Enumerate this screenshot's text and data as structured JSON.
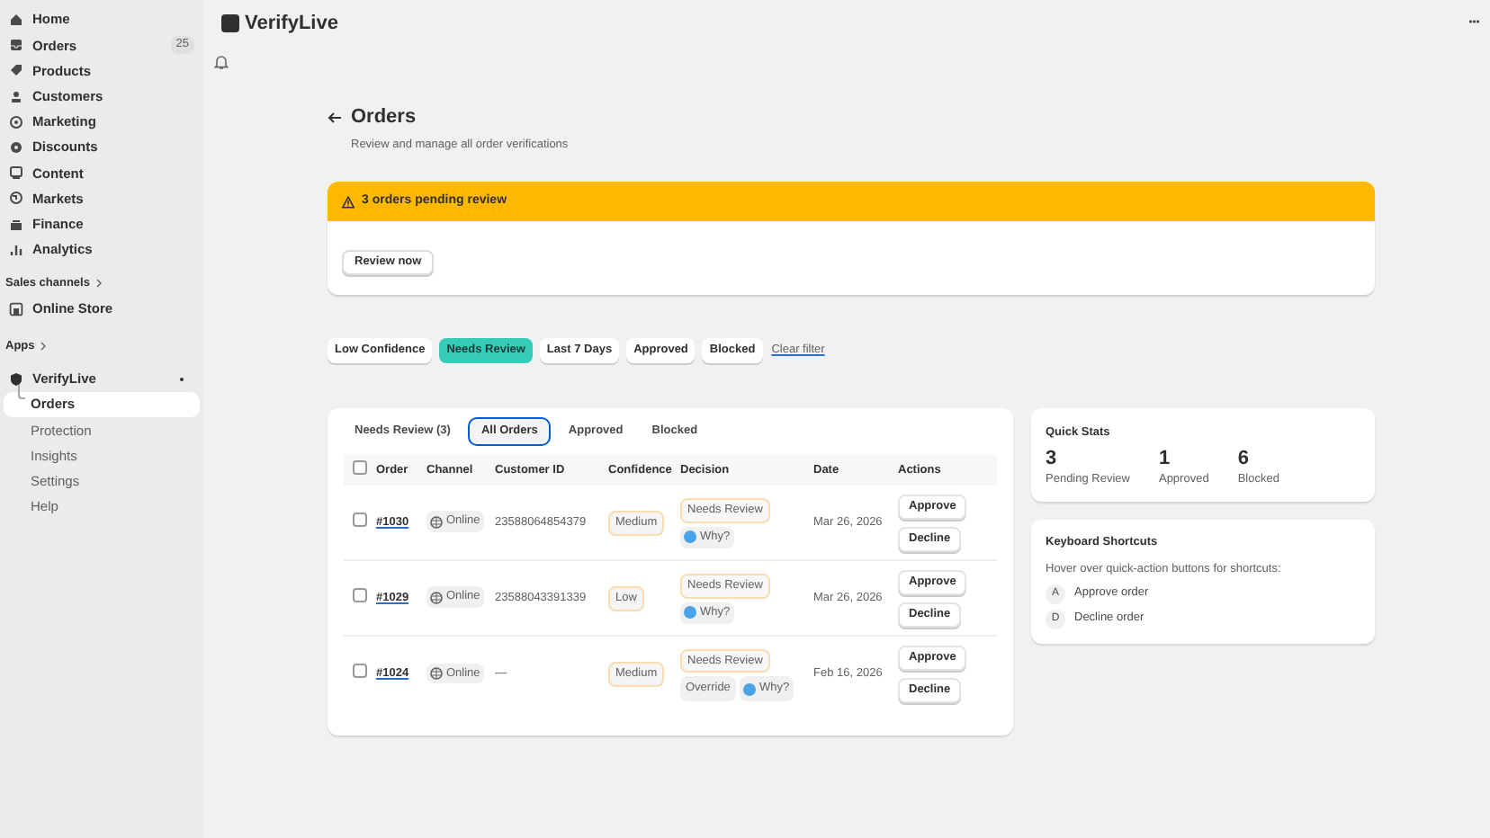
{
  "sidebar": {
    "items": [
      {
        "label": "Home"
      },
      {
        "label": "Orders",
        "badge": "25"
      },
      {
        "label": "Products"
      },
      {
        "label": "Customers"
      },
      {
        "label": "Marketing"
      },
      {
        "label": "Discounts"
      },
      {
        "label": "Content"
      },
      {
        "label": "Markets"
      },
      {
        "label": "Finance"
      },
      {
        "label": "Analytics"
      }
    ],
    "sales_channels": {
      "heading": "Sales channels",
      "items": [
        {
          "label": "Online Store"
        }
      ]
    },
    "apps": {
      "heading": "Apps",
      "app": {
        "label": "VerifyLive",
        "children": [
          {
            "label": "Orders",
            "selected": true
          },
          {
            "label": "Protection",
            "selected": false
          },
          {
            "label": "Insights",
            "selected": false
          },
          {
            "label": "Settings",
            "selected": false
          },
          {
            "label": "Help",
            "selected": false
          }
        ]
      }
    }
  },
  "topbar": {
    "title": "VerifyLive",
    "menu": "···"
  },
  "page": {
    "title": "Orders",
    "subtitle": "Review and manage all order verifications"
  },
  "banner": {
    "message": "3 orders pending review",
    "button": "Review now"
  },
  "filters": {
    "chips": [
      {
        "label": "Low Confidence",
        "selected": false
      },
      {
        "label": "Needs Review",
        "selected": true
      },
      {
        "label": "Last 7 Days",
        "selected": false
      },
      {
        "label": "Approved",
        "selected": false
      },
      {
        "label": "Blocked",
        "selected": false
      }
    ],
    "clear": "Clear filter"
  },
  "table": {
    "tabs": [
      {
        "label": "Needs Review (3)",
        "selected": false
      },
      {
        "label": "All Orders",
        "selected": true
      },
      {
        "label": "Approved",
        "selected": false
      },
      {
        "label": "Blocked",
        "selected": false
      }
    ],
    "select_all": {
      "checked": false
    },
    "columns": [
      "Order",
      "Channel",
      "Customer ID",
      "Confidence",
      "Decision",
      "Date",
      "Actions"
    ],
    "rows": [
      {
        "checked": false,
        "order": "#1030",
        "channel": "Online",
        "customer_id": "23588064854379",
        "confidence": "Medium",
        "decision": [
          {
            "kind": "status",
            "label": "Needs Review"
          },
          {
            "kind": "why",
            "label": "Why?"
          }
        ],
        "date": "Mar 26, 2026",
        "actions": [
          "Approve",
          "Decline"
        ]
      },
      {
        "checked": false,
        "order": "#1029",
        "channel": "Online",
        "customer_id": "23588043391339",
        "confidence": "Low",
        "decision": [
          {
            "kind": "status",
            "label": "Needs Review"
          },
          {
            "kind": "why",
            "label": "Why?"
          }
        ],
        "date": "Mar 26, 2026",
        "actions": [
          "Approve",
          "Decline"
        ]
      },
      {
        "checked": false,
        "order": "#1024",
        "channel": "Online",
        "customer_id": "—",
        "confidence": "Medium",
        "decision": [
          {
            "kind": "status",
            "label": "Needs Review"
          },
          {
            "kind": "override",
            "label": "Override"
          },
          {
            "kind": "why",
            "label": "Why?"
          }
        ],
        "date": "Feb 16, 2026",
        "actions": [
          "Approve",
          "Decline"
        ]
      }
    ]
  },
  "quick_stats": {
    "title": "Quick Stats",
    "stats": [
      {
        "value": "3",
        "label": "Pending Review"
      },
      {
        "value": "1",
        "label": "Approved"
      },
      {
        "value": "6",
        "label": "Blocked"
      }
    ]
  },
  "shortcuts": {
    "title": "Keyboard Shortcuts",
    "hint": "Hover over quick-action buttons for shortcuts:",
    "items": [
      {
        "key": "A",
        "label": "Approve order"
      },
      {
        "key": "D",
        "label": "Decline order"
      }
    ]
  }
}
